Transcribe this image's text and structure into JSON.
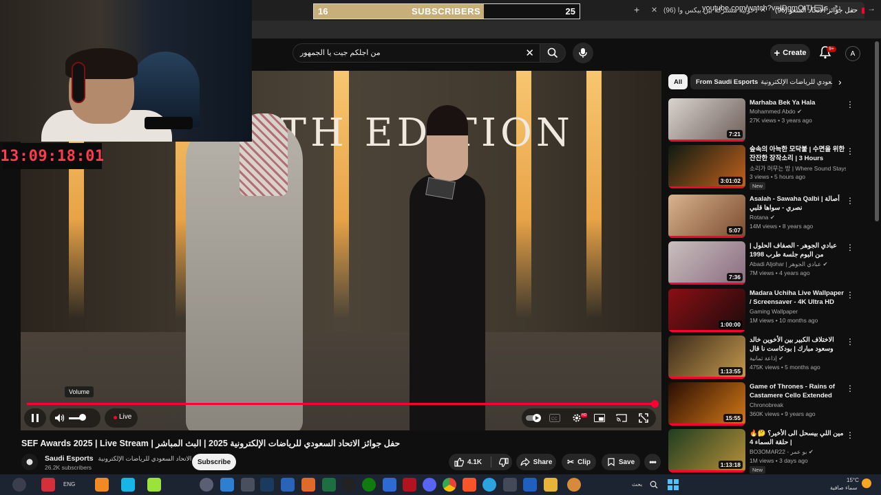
{
  "browser": {
    "tabs": [
      {
        "label": "(96) حفل جوائز الاتحاد السعو",
        "active": true
      },
      {
        "label": "(96) دخولية مشتركة بين بيكس وا",
        "active": false
      }
    ],
    "url": "youtube.com/watch?v=IDgmQtTH_1s"
  },
  "subscribers_overlay": {
    "current": "16",
    "label": "SUBSCRIBERS",
    "goal": "25",
    "progress": 0.64
  },
  "stream_timer": "13:09:18:01",
  "search": {
    "query": "من اجلكم جيت يا الجمهور"
  },
  "header": {
    "create_label": "Create",
    "notification_count": "9+",
    "avatar_letter": "A"
  },
  "player": {
    "edition_text": "5TH EDITION",
    "volume_tooltip": "Volume",
    "live_label": "Live",
    "hd_badge": "HD",
    "progress": 1.0
  },
  "video": {
    "title": "حفل جوائز الاتحاد السعودي للرياضات الإلكترونية 2025 | البث المباشر | SEF Awards 2025 | Live Stream",
    "channel_name": "Saudi Esports",
    "channel_name_ar": "الاتحاد السعودي للرياضات الإلكترونية",
    "subscribers": "26.2K subscribers",
    "subscribe_label": "Subscribe",
    "likes": "4.1K",
    "share_label": "Share",
    "clip_label": "Clip",
    "save_label": "Save"
  },
  "chips": {
    "all": "All",
    "from": "From Saudi Esports",
    "extra": "الاتحاد السعودي للرياضات الإلكترونية"
  },
  "recommendations": [
    {
      "title": "Marhaba Bek Ya Hala",
      "channel": "Mohammed Abdo",
      "verified": true,
      "meta": "27K views • 3 years ago",
      "duration": "7:21",
      "new": "",
      "colors": [
        "#d9d4cf",
        "#6d5d58"
      ]
    },
    {
      "title": "숲속의 아늑한 모닥불 | 수면을 위한 잔잔한 장작소리 | 3 Hours",
      "channel": "소리가 머무는 방 | Where Sound Stays",
      "verified": false,
      "meta": "3 views • 5 hours ago",
      "duration": "3:01:02",
      "new": "New",
      "colors": [
        "#0e1a12",
        "#c4621c"
      ]
    },
    {
      "title": "Asalah - Sawaha Qalbi | أصالة نصري - سواها قلبي",
      "channel": "Rotana",
      "verified": true,
      "meta": "14M views • 8 years ago",
      "duration": "5:07",
      "new": "",
      "colors": [
        "#d9b38f",
        "#7a4b2e"
      ]
    },
    {
      "title": "عبادي الجوهر - الصفاف الحلول | من البوم جلسة طرب 1998",
      "channel": "Abadi Aljohar | عبادي الجوهر",
      "verified": true,
      "meta": "7M views • 4 years ago",
      "duration": "7:36",
      "new": "",
      "colors": [
        "#c9c0bd",
        "#8a6b80"
      ]
    },
    {
      "title": "Madara Uchiha Live Wallpaper / Screensaver - 4K Ultra HD",
      "channel": "Gaming Wallpaper",
      "verified": false,
      "meta": "1M views • 10 months ago",
      "duration": "1:00:00",
      "new": "",
      "colors": [
        "#8a0f14",
        "#1c0b0b"
      ]
    },
    {
      "title": "الاختلاف الكبير بين الأخوين خالد وسعود مبارك | بودكاست نا قال",
      "channel": "إذاعة ثمانية",
      "verified": true,
      "meta": "475K views • 5 months ago",
      "duration": "1:13:55",
      "new": "",
      "colors": [
        "#3b2a1a",
        "#c49a4e"
      ]
    },
    {
      "title": "Game of Thrones - Rains of Castamere Cello Extended",
      "channel": "Chronobreak",
      "verified": false,
      "meta": "360K views • 9 years ago",
      "duration": "15:55",
      "new": "",
      "colors": [
        "#2a0d04",
        "#d47a17"
      ]
    },
    {
      "title": "مين اللي بيسحل الى الأخير؟ 🤔🔥 | حلقة السماء 4",
      "channel": "BO3OMAR22 - بو عمر",
      "verified": true,
      "meta": "1M views • 3 days ago",
      "duration": "1:13:18",
      "new": "New",
      "colors": [
        "#1f3d1f",
        "#b8913a"
      ]
    }
  ],
  "taskbar": {
    "language": "ENG",
    "weather_temp": "15°C",
    "weather_text": "سماء صافية",
    "search_text": "بحث"
  },
  "colors": {
    "accent_red": "#ff0033",
    "overlay_gold": "#c8ae78",
    "timer_red": "#ff3b4d",
    "background": "#0f0f0f"
  }
}
